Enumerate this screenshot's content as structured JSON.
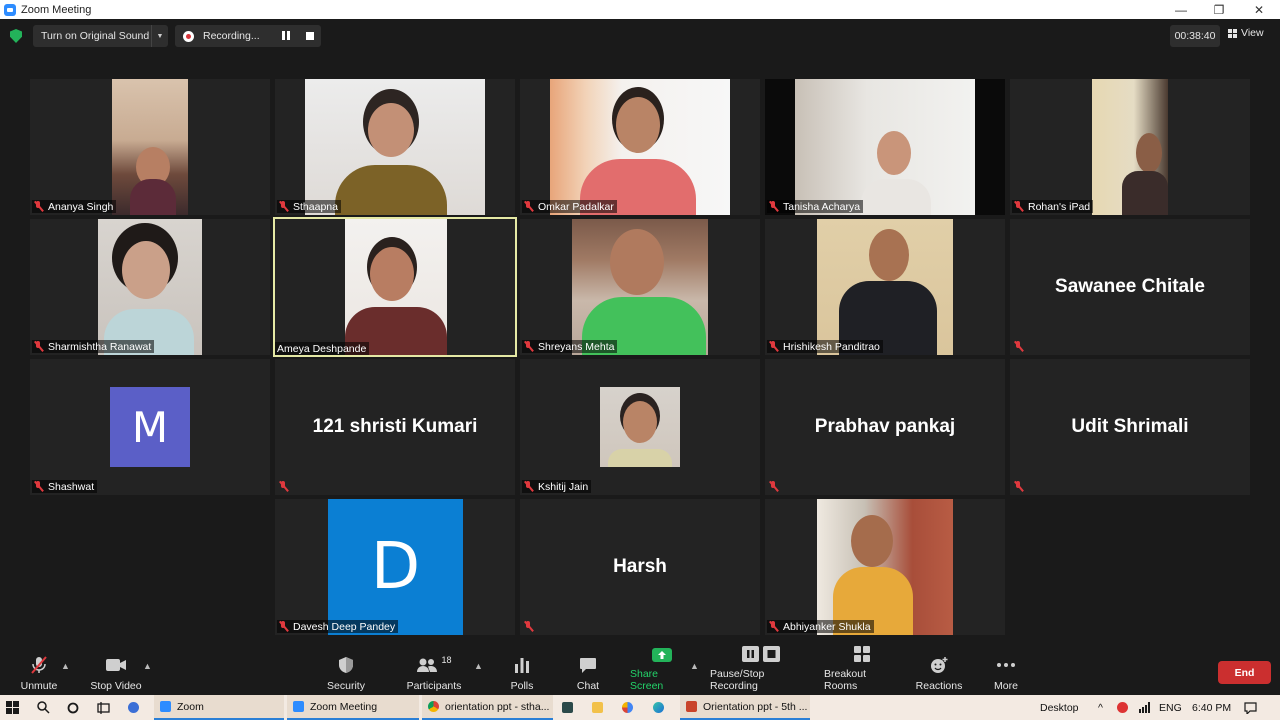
{
  "window": {
    "title": "Zoom Meeting",
    "minimize": "—",
    "restore": "❐",
    "close": "✕"
  },
  "topbar": {
    "original_sound": "Turn on Original Sound",
    "recording": "Recording...",
    "timer": "00:38:40",
    "view": "View"
  },
  "participants": [
    {
      "name": "Ananya Singh"
    },
    {
      "name": "Sthaapna"
    },
    {
      "name": "Omkar Padalkar"
    },
    {
      "name": "Tanisha Acharya"
    },
    {
      "name": "Rohan's iPad"
    },
    {
      "name": "Sharmishtha Ranawat"
    },
    {
      "name": "Ameya Deshpande"
    },
    {
      "name": "Shreyans Mehta"
    },
    {
      "name": "Hrishikesh Panditrao"
    },
    {
      "name": "Sawanee Chitale"
    },
    {
      "name": "Shashwat",
      "avatar_letter": "M",
      "avatar_color": "#5b5fc7"
    },
    {
      "name": "121 shristi Kumari"
    },
    {
      "name": "Kshitij Jain"
    },
    {
      "name": "Prabhav pankaj"
    },
    {
      "name": "Udit Shrimali"
    },
    {
      "name": "Davesh Deep Pandey",
      "avatar_letter": "D",
      "avatar_color": "#0b7fd3"
    },
    {
      "name": "Harsh"
    },
    {
      "name": "Abhiyanker Shukla"
    }
  ],
  "toolbar": {
    "unmute": "Unmute",
    "stop_video": "Stop Video",
    "security": "Security",
    "participants": "Participants",
    "participants_count": "18",
    "polls": "Polls",
    "chat": "Chat",
    "share_screen": "Share Screen",
    "pause_stop_recording": "Pause/Stop Recording",
    "breakout_rooms": "Breakout Rooms",
    "reactions": "Reactions",
    "more": "More",
    "end": "End"
  },
  "taskbar": {
    "apps": [
      {
        "label": "Zoom"
      },
      {
        "label": "Zoom Meeting"
      },
      {
        "label": "orientation ppt - stha..."
      },
      {
        "label": "Orientation ppt - 5th ..."
      }
    ],
    "desktop": "Desktop",
    "language": "ENG",
    "time": "6:40 PM"
  },
  "colors": {
    "accent": "#2d8cff",
    "end": "#cb2f2f",
    "active_speaker": "#e4e8a4",
    "share": "#23b35a"
  }
}
